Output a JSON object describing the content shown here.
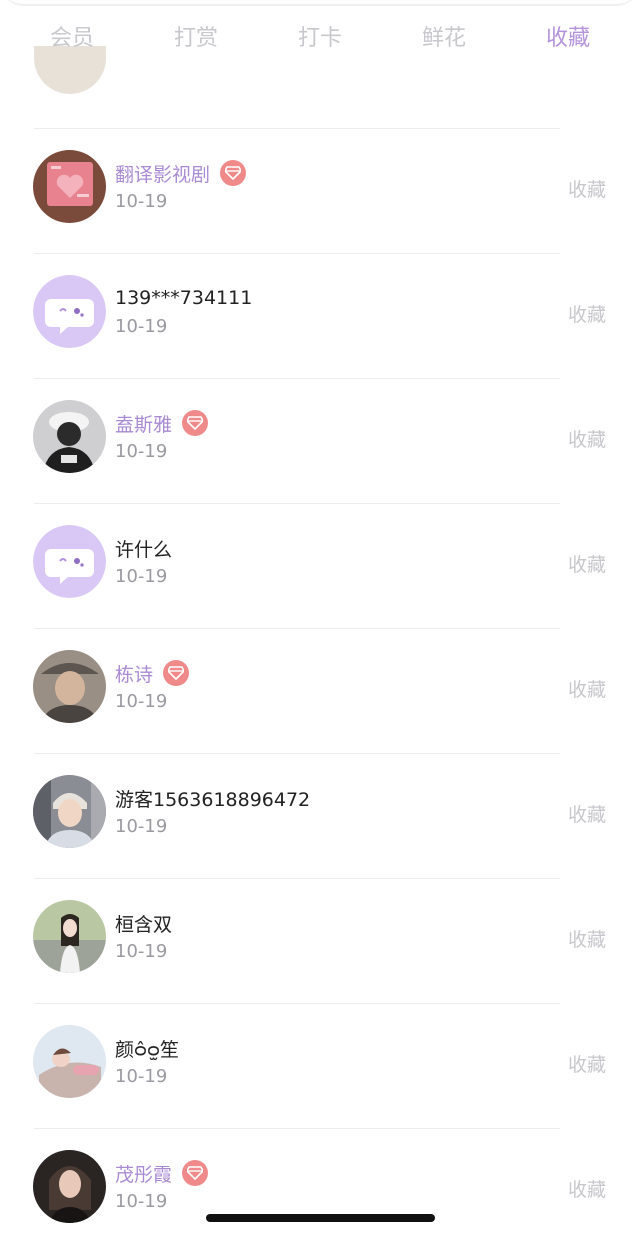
{
  "tabs": [
    {
      "label": "会员",
      "active": false
    },
    {
      "label": "打赏",
      "active": false
    },
    {
      "label": "打卡",
      "active": false
    },
    {
      "label": "鲜花",
      "active": false
    },
    {
      "label": "收藏",
      "active": true
    }
  ],
  "colors": {
    "accent": "#b494dc",
    "vip_name": "#a98bd3",
    "vip_badge": "#f08a8a",
    "inactive_tab": "#c8c8cc",
    "date": "#9a9aa0"
  },
  "list": [
    {
      "name": "翻译影视剧",
      "vip": true,
      "date": "10-19",
      "action": "收藏",
      "avatar": "photo-pink-card"
    },
    {
      "name": "139***734111",
      "vip": false,
      "date": "10-19",
      "action": "收藏",
      "avatar": "default-chat-bubble"
    },
    {
      "name": "盍斯雅",
      "vip": true,
      "date": "10-19",
      "action": "收藏",
      "avatar": "photo-cap-person"
    },
    {
      "name": "许什么",
      "vip": false,
      "date": "10-19",
      "action": "收藏",
      "avatar": "default-chat-bubble"
    },
    {
      "name": "栋诗",
      "vip": true,
      "date": "10-19",
      "action": "收藏",
      "avatar": "photo-person-hat"
    },
    {
      "name": "游客1563618896472",
      "vip": false,
      "date": "10-19",
      "action": "收藏",
      "avatar": "photo-person"
    },
    {
      "name": "桓含双",
      "vip": false,
      "date": "10-19",
      "action": "收藏",
      "avatar": "photo-girl-road"
    },
    {
      "name": "颜ᴑ̂ᴑ̫笙",
      "vip": false,
      "date": "10-19",
      "action": "收藏",
      "avatar": "photo-girl-lying"
    },
    {
      "name": "茂彤霞",
      "vip": true,
      "date": "10-19",
      "action": "收藏",
      "avatar": "photo-girl-dark"
    }
  ]
}
